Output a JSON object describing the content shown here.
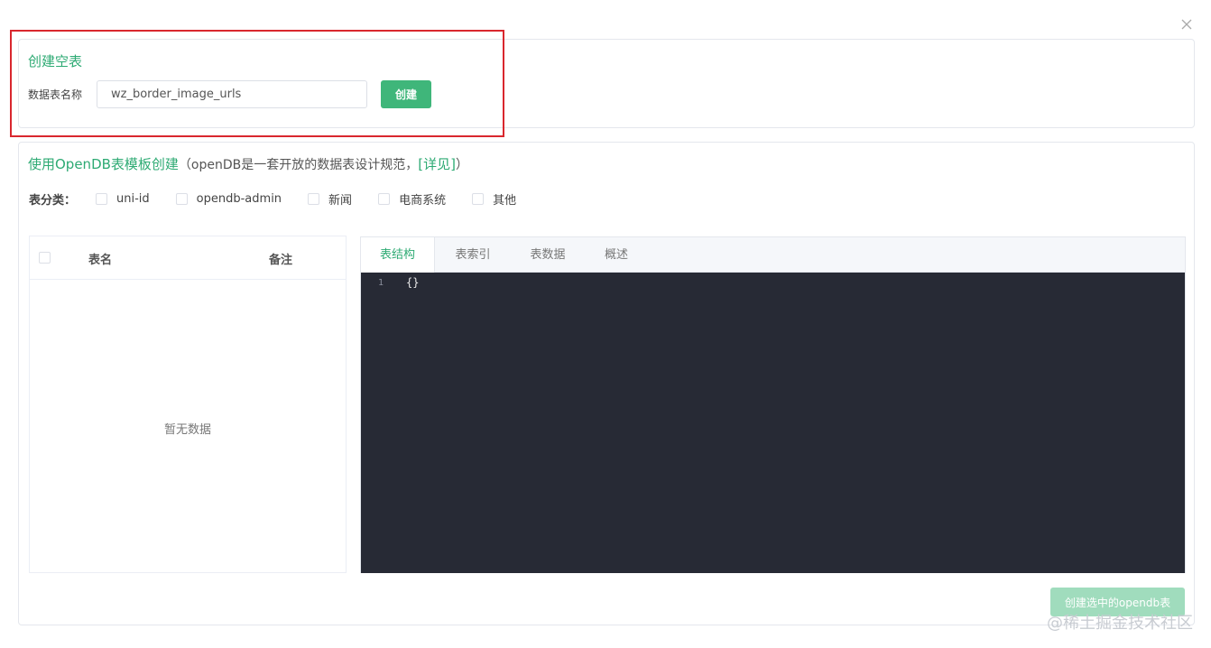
{
  "empty_table": {
    "title": "创建空表",
    "name_label": "数据表名称",
    "name_value": "wz_border_image_urls",
    "create_button": "创建"
  },
  "opendb": {
    "title": "使用OpenDB表模板创建",
    "desc_prefix": "（openDB是一套开放的数据表设计规范，",
    "desc_link": "[详见]",
    "desc_suffix": "）",
    "category_label": "表分类：",
    "categories": [
      {
        "label": "uni-id",
        "checked": false
      },
      {
        "label": "opendb-admin",
        "checked": false
      },
      {
        "label": "新闻",
        "checked": false
      },
      {
        "label": "电商系统",
        "checked": false
      },
      {
        "label": "其他",
        "checked": false
      }
    ],
    "table": {
      "columns": [
        "表名",
        "备注"
      ],
      "empty_text": "暂无数据"
    },
    "tabs": [
      {
        "label": "表结构",
        "active": true
      },
      {
        "label": "表索引",
        "active": false
      },
      {
        "label": "表数据",
        "active": false
      },
      {
        "label": "概述",
        "active": false
      }
    ],
    "editor": {
      "line_number": "1",
      "content": "{}"
    },
    "submit_button": "创建选中的opendb表"
  },
  "watermark": "@稀土掘金技术社区",
  "colors": {
    "accent": "#2daa73",
    "primary_button": "#3fb67a",
    "disabled_button": "#a0dcbd",
    "editor_bg": "#272a35",
    "highlight": "#d9272e"
  }
}
